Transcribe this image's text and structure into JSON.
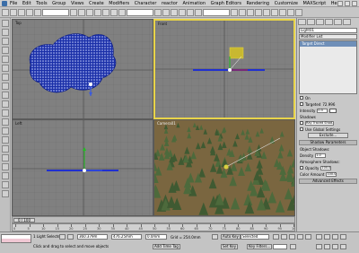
{
  "menubar": {
    "items": [
      "File",
      "Edit",
      "Tools",
      "Group",
      "Views",
      "Create",
      "Modifiers",
      "Character",
      "reactor",
      "Animation",
      "Graph Editors",
      "Rendering",
      "Customize",
      "MAXScript",
      "Help"
    ]
  },
  "viewports": {
    "top_label": "Top",
    "front_label": "Front",
    "left_label": "Left",
    "camera_label": "Camera01"
  },
  "command_panel": {
    "name_value": "Light01",
    "modifier_list": "Modifier List",
    "stack_selected": "Target Direct",
    "on_label": "On",
    "targeted_label": "Targeted",
    "targeted_value": "72.996",
    "intensity_label": "Intensity",
    "intensity_value": "0.5",
    "shadows_label": "Shadows",
    "shadow_type": "Ray Traced Shad.",
    "use_global_label": "Use Global Settings",
    "exclude_label": "Exclude...",
    "shadow_params_label": "Shadow Parameters",
    "object_shadows_label": "Object Shadows:",
    "density_label": "Density",
    "density_value": "1.0",
    "atmo_label": "Atmosphere Shadows:",
    "opacity_label": "Opacity",
    "opacity_value": "100.0",
    "color_amount_label": "Color Amount",
    "color_amount_value": "100.0",
    "advanced_label": "Advanced Effects"
  },
  "timeline": {
    "position": "0 / 100",
    "ruler": [
      "0",
      "5",
      "10",
      "15",
      "20",
      "25",
      "30",
      "35",
      "40",
      "45",
      "50",
      "55",
      "60",
      "65",
      "70",
      "75",
      "80",
      "85",
      "90",
      "95",
      "100"
    ]
  },
  "status": {
    "selected": "1 Light Selected",
    "prompt": "Click and drag to select and move objects",
    "x": "360.379m",
    "y": "476.25mm",
    "z": "0.0mm",
    "grid": "Grid = 254.0mm",
    "add_time_tag": "Add Time Tag",
    "auto_key": "Auto Key",
    "set_key": "Set Key",
    "selected_dd": "Selected",
    "key_filters": "Key Filters..."
  }
}
